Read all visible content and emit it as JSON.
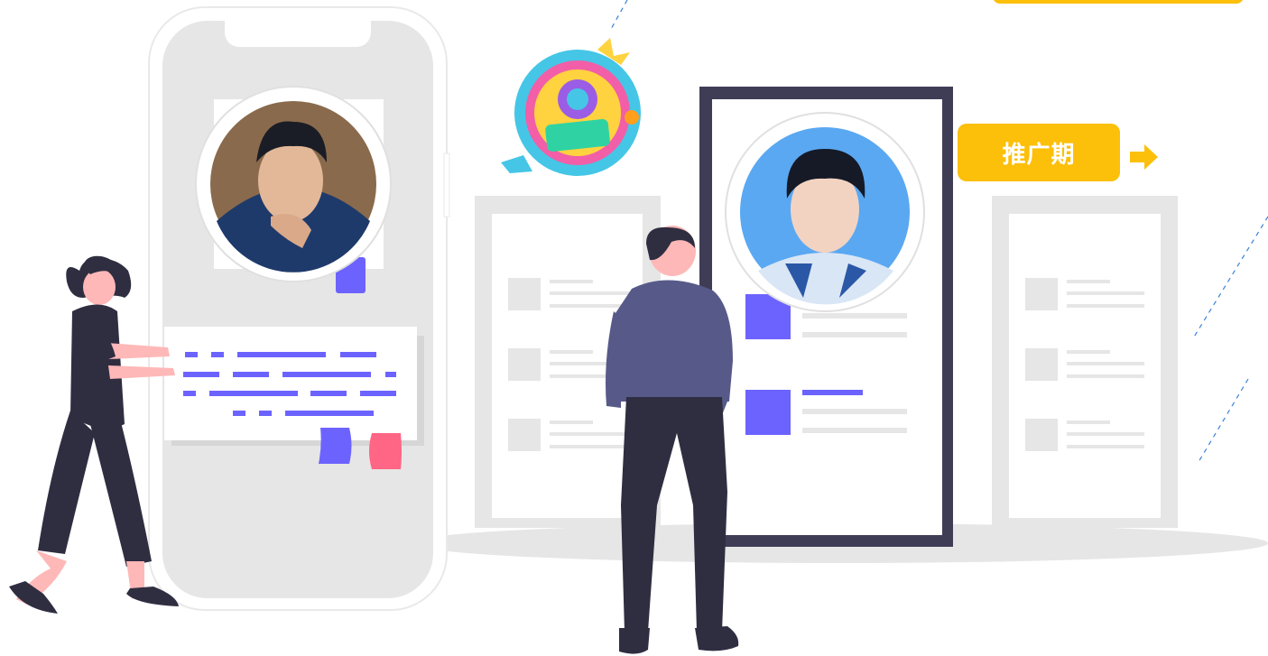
{
  "badge": {
    "label": "推广期"
  },
  "icons": {
    "arrow": "right-arrow-icon",
    "logo": "variety-show-logo",
    "avatar_left": "male-portrait-avatar",
    "avatar_right": "male-portrait-avatar"
  },
  "colors": {
    "accent": "#fcbf0a",
    "purple": "#6c63ff",
    "pink": "#ff6584",
    "dark": "#2f2e41",
    "frame": "#3f3d56",
    "panel": "#e6e6e6",
    "shirt": "#575a89"
  }
}
